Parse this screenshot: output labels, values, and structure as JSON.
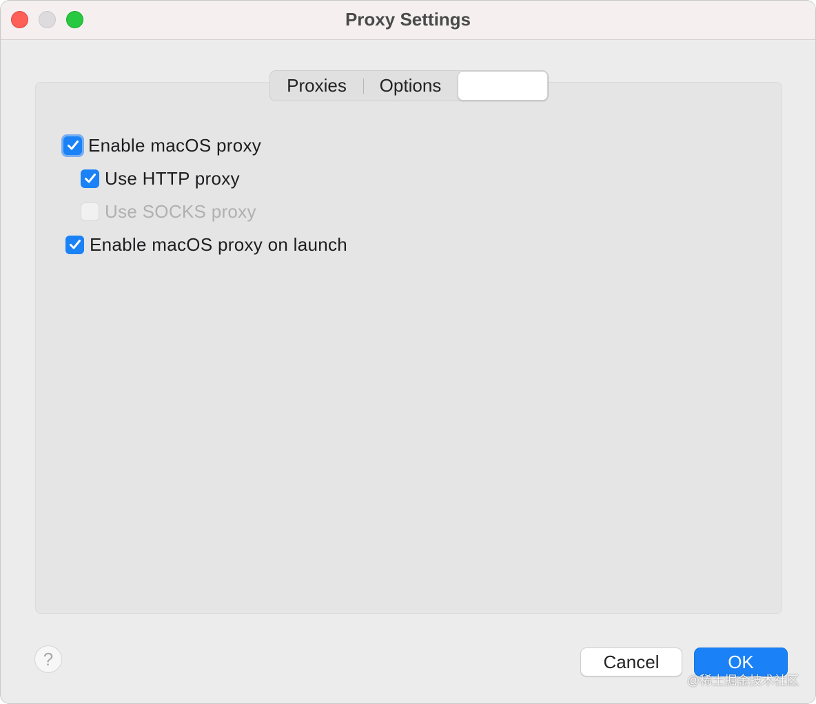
{
  "window": {
    "title": "Proxy Settings"
  },
  "tabs": [
    {
      "label": "Proxies"
    },
    {
      "label": "Options"
    },
    {
      "label": ""
    }
  ],
  "options": {
    "enable_macos_proxy": {
      "label": "Enable macOS proxy",
      "checked": true
    },
    "use_http_proxy": {
      "label": "Use HTTP proxy",
      "checked": true
    },
    "use_socks_proxy": {
      "label": "Use SOCKS proxy",
      "checked": false,
      "disabled": true
    },
    "enable_on_launch": {
      "label": "Enable macOS proxy on launch",
      "checked": true
    }
  },
  "footer": {
    "help_label": "?",
    "cancel_label": "Cancel",
    "ok_label": "OK"
  },
  "watermark": "@稀土掘金技术社区",
  "colors": {
    "accent": "#1a82f6",
    "close": "#fe5f57",
    "zoom": "#28c840"
  }
}
